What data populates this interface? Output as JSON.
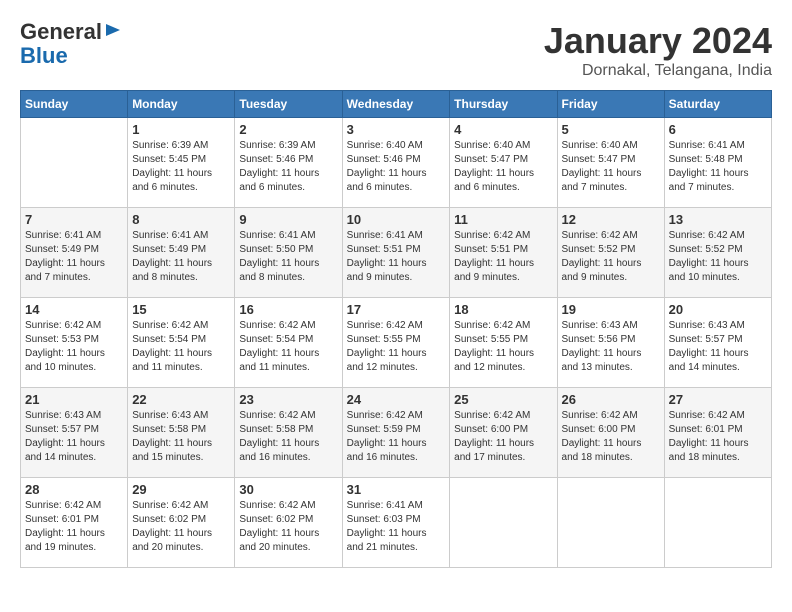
{
  "header": {
    "logo_line1": "General",
    "logo_line2": "Blue",
    "month": "January 2024",
    "location": "Dornakal, Telangana, India"
  },
  "days_of_week": [
    "Sunday",
    "Monday",
    "Tuesday",
    "Wednesday",
    "Thursday",
    "Friday",
    "Saturday"
  ],
  "weeks": [
    [
      {
        "day": "",
        "info": ""
      },
      {
        "day": "1",
        "info": "Sunrise: 6:39 AM\nSunset: 5:45 PM\nDaylight: 11 hours\nand 6 minutes."
      },
      {
        "day": "2",
        "info": "Sunrise: 6:39 AM\nSunset: 5:46 PM\nDaylight: 11 hours\nand 6 minutes."
      },
      {
        "day": "3",
        "info": "Sunrise: 6:40 AM\nSunset: 5:46 PM\nDaylight: 11 hours\nand 6 minutes."
      },
      {
        "day": "4",
        "info": "Sunrise: 6:40 AM\nSunset: 5:47 PM\nDaylight: 11 hours\nand 6 minutes."
      },
      {
        "day": "5",
        "info": "Sunrise: 6:40 AM\nSunset: 5:47 PM\nDaylight: 11 hours\nand 7 minutes."
      },
      {
        "day": "6",
        "info": "Sunrise: 6:41 AM\nSunset: 5:48 PM\nDaylight: 11 hours\nand 7 minutes."
      }
    ],
    [
      {
        "day": "7",
        "info": "Sunrise: 6:41 AM\nSunset: 5:49 PM\nDaylight: 11 hours\nand 7 minutes."
      },
      {
        "day": "8",
        "info": "Sunrise: 6:41 AM\nSunset: 5:49 PM\nDaylight: 11 hours\nand 8 minutes."
      },
      {
        "day": "9",
        "info": "Sunrise: 6:41 AM\nSunset: 5:50 PM\nDaylight: 11 hours\nand 8 minutes."
      },
      {
        "day": "10",
        "info": "Sunrise: 6:41 AM\nSunset: 5:51 PM\nDaylight: 11 hours\nand 9 minutes."
      },
      {
        "day": "11",
        "info": "Sunrise: 6:42 AM\nSunset: 5:51 PM\nDaylight: 11 hours\nand 9 minutes."
      },
      {
        "day": "12",
        "info": "Sunrise: 6:42 AM\nSunset: 5:52 PM\nDaylight: 11 hours\nand 9 minutes."
      },
      {
        "day": "13",
        "info": "Sunrise: 6:42 AM\nSunset: 5:52 PM\nDaylight: 11 hours\nand 10 minutes."
      }
    ],
    [
      {
        "day": "14",
        "info": "Sunrise: 6:42 AM\nSunset: 5:53 PM\nDaylight: 11 hours\nand 10 minutes."
      },
      {
        "day": "15",
        "info": "Sunrise: 6:42 AM\nSunset: 5:54 PM\nDaylight: 11 hours\nand 11 minutes."
      },
      {
        "day": "16",
        "info": "Sunrise: 6:42 AM\nSunset: 5:54 PM\nDaylight: 11 hours\nand 11 minutes."
      },
      {
        "day": "17",
        "info": "Sunrise: 6:42 AM\nSunset: 5:55 PM\nDaylight: 11 hours\nand 12 minutes."
      },
      {
        "day": "18",
        "info": "Sunrise: 6:42 AM\nSunset: 5:55 PM\nDaylight: 11 hours\nand 12 minutes."
      },
      {
        "day": "19",
        "info": "Sunrise: 6:43 AM\nSunset: 5:56 PM\nDaylight: 11 hours\nand 13 minutes."
      },
      {
        "day": "20",
        "info": "Sunrise: 6:43 AM\nSunset: 5:57 PM\nDaylight: 11 hours\nand 14 minutes."
      }
    ],
    [
      {
        "day": "21",
        "info": "Sunrise: 6:43 AM\nSunset: 5:57 PM\nDaylight: 11 hours\nand 14 minutes."
      },
      {
        "day": "22",
        "info": "Sunrise: 6:43 AM\nSunset: 5:58 PM\nDaylight: 11 hours\nand 15 minutes."
      },
      {
        "day": "23",
        "info": "Sunrise: 6:42 AM\nSunset: 5:58 PM\nDaylight: 11 hours\nand 16 minutes."
      },
      {
        "day": "24",
        "info": "Sunrise: 6:42 AM\nSunset: 5:59 PM\nDaylight: 11 hours\nand 16 minutes."
      },
      {
        "day": "25",
        "info": "Sunrise: 6:42 AM\nSunset: 6:00 PM\nDaylight: 11 hours\nand 17 minutes."
      },
      {
        "day": "26",
        "info": "Sunrise: 6:42 AM\nSunset: 6:00 PM\nDaylight: 11 hours\nand 18 minutes."
      },
      {
        "day": "27",
        "info": "Sunrise: 6:42 AM\nSunset: 6:01 PM\nDaylight: 11 hours\nand 18 minutes."
      }
    ],
    [
      {
        "day": "28",
        "info": "Sunrise: 6:42 AM\nSunset: 6:01 PM\nDaylight: 11 hours\nand 19 minutes."
      },
      {
        "day": "29",
        "info": "Sunrise: 6:42 AM\nSunset: 6:02 PM\nDaylight: 11 hours\nand 20 minutes."
      },
      {
        "day": "30",
        "info": "Sunrise: 6:42 AM\nSunset: 6:02 PM\nDaylight: 11 hours\nand 20 minutes."
      },
      {
        "day": "31",
        "info": "Sunrise: 6:41 AM\nSunset: 6:03 PM\nDaylight: 11 hours\nand 21 minutes."
      },
      {
        "day": "",
        "info": ""
      },
      {
        "day": "",
        "info": ""
      },
      {
        "day": "",
        "info": ""
      }
    ]
  ]
}
